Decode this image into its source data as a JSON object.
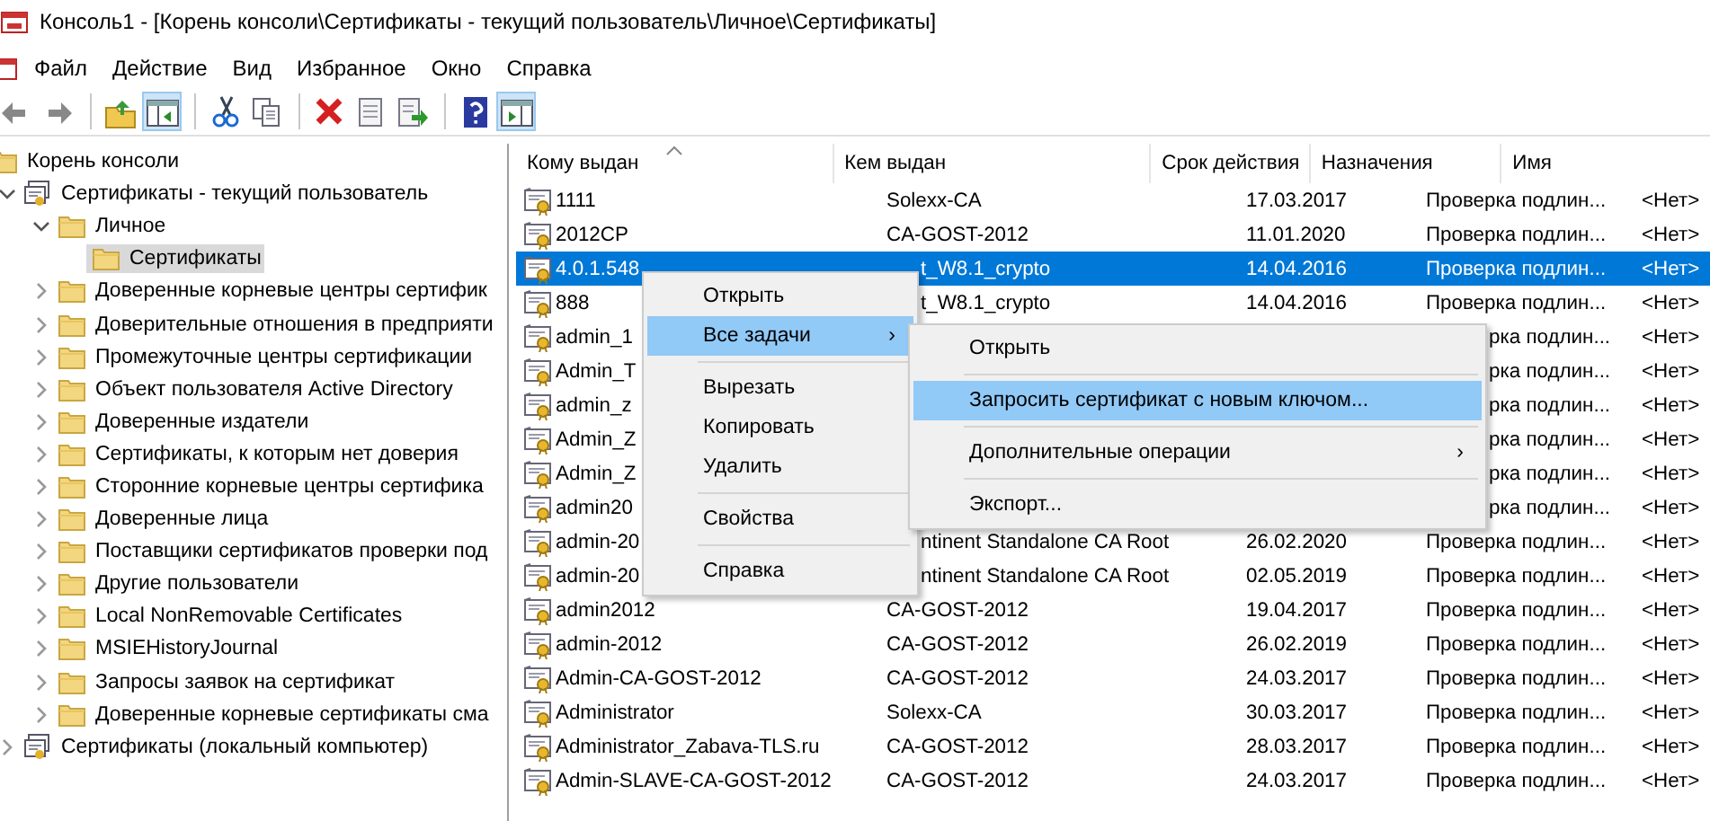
{
  "window": {
    "title": "Консоль1 - [Корень консоли\\Сертификаты - текущий пользователь\\Личное\\Сертификаты]"
  },
  "menu_bar": [
    "Файл",
    "Действие",
    "Вид",
    "Избранное",
    "Окно",
    "Справка"
  ],
  "toolbar": [
    {
      "kind": "back",
      "pressed": false
    },
    {
      "kind": "forward",
      "pressed": false
    },
    {
      "kind": "separator"
    },
    {
      "kind": "up",
      "pressed": false
    },
    {
      "kind": "tree-pane",
      "pressed": true
    },
    {
      "kind": "separator"
    },
    {
      "kind": "cut",
      "pressed": false
    },
    {
      "kind": "copy",
      "pressed": false
    },
    {
      "kind": "separator"
    },
    {
      "kind": "delete",
      "pressed": false
    },
    {
      "kind": "properties",
      "pressed": false
    },
    {
      "kind": "export",
      "pressed": false
    },
    {
      "kind": "separator"
    },
    {
      "kind": "help",
      "pressed": false
    },
    {
      "kind": "action-pane",
      "pressed": true
    }
  ],
  "tree": [
    {
      "label": "Корень консоли",
      "kind": "folder",
      "selected": false,
      "children": [
        {
          "label": "Сертификаты - текущий пользователь",
          "kind": "store",
          "expanded": true,
          "selected": false,
          "children": [
            {
              "label": "Личное",
              "kind": "folder",
              "expanded": true,
              "selected": false,
              "children": [
                {
                  "label": "Сертификаты",
                  "kind": "folder",
                  "selected": true
                }
              ]
            },
            {
              "label": "Доверенные корневые центры сертифик",
              "kind": "folder",
              "expanded": false,
              "selected": false
            },
            {
              "label": "Доверительные отношения в предприяти",
              "kind": "folder",
              "expanded": false,
              "selected": false
            },
            {
              "label": "Промежуточные центры сертификации",
              "kind": "folder",
              "expanded": false,
              "selected": false
            },
            {
              "label": "Объект пользователя Active Directory",
              "kind": "folder",
              "expanded": false,
              "selected": false
            },
            {
              "label": "Доверенные издатели",
              "kind": "folder",
              "expanded": false,
              "selected": false
            },
            {
              "label": "Сертификаты, к которым нет доверия",
              "kind": "folder",
              "expanded": false,
              "selected": false
            },
            {
              "label": "Сторонние корневые центры сертифика",
              "kind": "folder",
              "expanded": false,
              "selected": false
            },
            {
              "label": "Доверенные лица",
              "kind": "folder",
              "expanded": false,
              "selected": false
            },
            {
              "label": "Поставщики сертификатов проверки под",
              "kind": "folder",
              "expanded": false,
              "selected": false
            },
            {
              "label": "Другие пользователи",
              "kind": "folder",
              "expanded": false,
              "selected": false
            },
            {
              "label": "Local NonRemovable Certificates",
              "kind": "folder",
              "expanded": false,
              "selected": false
            },
            {
              "label": "MSIEHistoryJournal",
              "kind": "folder",
              "expanded": false,
              "selected": false
            },
            {
              "label": "Запросы заявок на сертификат",
              "kind": "folder",
              "expanded": false,
              "selected": false
            },
            {
              "label": "Доверенные корневые сертификаты сма",
              "kind": "folder",
              "expanded": false,
              "selected": false
            }
          ]
        },
        {
          "label": "Сертификаты (локальный компьютер)",
          "kind": "store",
          "expanded": false,
          "selected": false
        }
      ]
    }
  ],
  "list": {
    "columns": [
      {
        "label": "Кому выдан",
        "sorted": true
      },
      {
        "label": "Кем выдан",
        "sorted": false
      },
      {
        "label": "Срок действия",
        "sorted": false
      },
      {
        "label": "Назначения",
        "sorted": false
      },
      {
        "label": "Имя",
        "sorted": false
      }
    ],
    "rows": [
      {
        "issued_to": "1111",
        "issued_by": "Solexx-CA",
        "expires": "17.03.2017",
        "purposes": "Проверка подлин...",
        "name": "<Нет>",
        "selected": false
      },
      {
        "issued_to": "2012CP",
        "issued_by": "CA-GOST-2012",
        "expires": "11.01.2020",
        "purposes": "Проверка подлин...",
        "name": "<Нет>",
        "selected": false
      },
      {
        "issued_to": "4.0.1.548",
        "issued_by": "t_W8.1_crypto",
        "expires": "14.04.2016",
        "purposes": "Проверка подлин...",
        "name": "<Нет>",
        "selected": true
      },
      {
        "issued_to": "888",
        "issued_by": "t_W8.1_crypto",
        "expires": "14.04.2016",
        "purposes": "Проверка подлин...",
        "name": "<Нет>",
        "selected": false
      },
      {
        "issued_to": "admin_1",
        "purposes": "рка подлин...",
        "name": "<Нет>",
        "selected": false
      },
      {
        "issued_to": "Admin_T",
        "purposes": "рка подлин...",
        "name": "<Нет>",
        "selected": false
      },
      {
        "issued_to": "admin_z",
        "purposes": "рка подлин...",
        "name": "<Нет>",
        "selected": false
      },
      {
        "issued_to": "Admin_Z",
        "purposes": "рка подлин...",
        "name": "<Нет>",
        "selected": false
      },
      {
        "issued_to": "Admin_Z",
        "purposes": "рка подлин...",
        "name": "<Нет>",
        "selected": false
      },
      {
        "issued_to": "admin20",
        "purposes": "рка подлин...",
        "name": "<Нет>",
        "selected": false
      },
      {
        "issued_to": "admin-20",
        "issued_by": "ntinent Standalone CA Root",
        "expires": "26.02.2020",
        "purposes": "Проверка подлин...",
        "name": "<Нет>",
        "selected": false
      },
      {
        "issued_to": "admin-20",
        "issued_by": "ntinent Standalone CA Root",
        "expires": "02.05.2019",
        "purposes": "Проверка подлин...",
        "name": "<Нет>",
        "selected": false
      },
      {
        "issued_to": "admin2012",
        "issued_by": "CA-GOST-2012",
        "expires": "19.04.2017",
        "purposes": "Проверка подлин...",
        "name": "<Нет>",
        "selected": false
      },
      {
        "issued_to": "admin-2012",
        "issued_by": "CA-GOST-2012",
        "expires": "26.02.2019",
        "purposes": "Проверка подлин...",
        "name": "<Нет>",
        "selected": false
      },
      {
        "issued_to": "Admin-CA-GOST-2012",
        "issued_by": "CA-GOST-2012",
        "expires": "24.03.2017",
        "purposes": "Проверка подлин...",
        "name": "<Нет>",
        "selected": false
      },
      {
        "issued_to": "Administrator",
        "issued_by": "Solexx-CA",
        "expires": "30.03.2017",
        "purposes": "Проверка подлин...",
        "name": "<Нет>",
        "selected": false
      },
      {
        "issued_to": "Administrator_Zabava-TLS.ru",
        "issued_by": "CA-GOST-2012",
        "expires": "28.03.2017",
        "purposes": "Проверка подлин...",
        "name": "<Нет>",
        "selected": false
      },
      {
        "issued_to": "Admin-SLAVE-CA-GOST-2012",
        "issued_by": "CA-GOST-2012",
        "expires": "24.03.2017",
        "purposes": "Проверка подлин...",
        "name": "<Нет>",
        "selected": false
      }
    ]
  },
  "context_menu": {
    "items": [
      {
        "kind": "item",
        "label": "Открыть",
        "selected": false
      },
      {
        "kind": "item",
        "label": "Все задачи",
        "selected": true,
        "arrow": "›"
      },
      {
        "kind": "separator"
      },
      {
        "kind": "item",
        "label": "Вырезать",
        "selected": false
      },
      {
        "kind": "item",
        "label": "Копировать",
        "selected": false
      },
      {
        "kind": "item",
        "label": "Удалить",
        "selected": false
      },
      {
        "kind": "separator"
      },
      {
        "kind": "item",
        "label": "Свойства",
        "selected": false
      },
      {
        "kind": "separator"
      },
      {
        "kind": "item",
        "label": "Справка",
        "selected": false
      }
    ]
  },
  "submenu": {
    "items": [
      {
        "kind": "item",
        "label": "Открыть",
        "selected": false
      },
      {
        "kind": "separator"
      },
      {
        "kind": "item",
        "label": "Запросить сертификат с новым ключом...",
        "selected": true
      },
      {
        "kind": "separator"
      },
      {
        "kind": "item",
        "label": "Дополнительные операции",
        "selected": false,
        "arrow": "›"
      },
      {
        "kind": "separator"
      },
      {
        "kind": "item",
        "label": "Экспорт...",
        "selected": false
      }
    ]
  }
}
